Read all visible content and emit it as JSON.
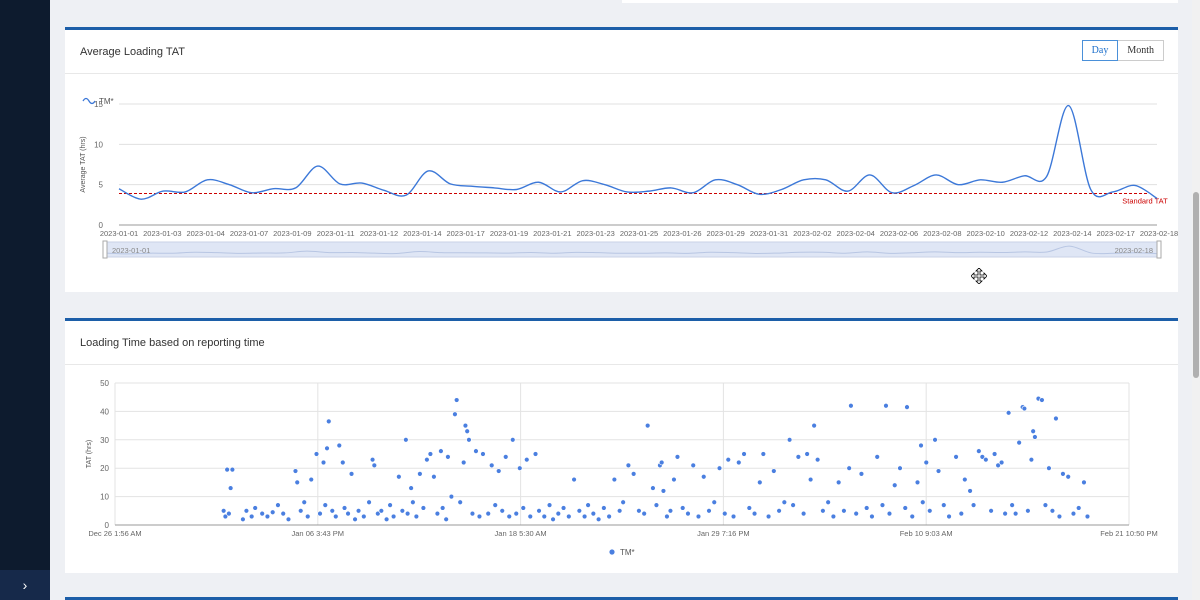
{
  "sidebar": {
    "toggle_icon": "chevron-right-icon",
    "toggle_glyph": "›"
  },
  "card1": {
    "title": "Average Loading TAT",
    "toggle": {
      "day_label": "Day",
      "month_label": "Month",
      "selected": "Day"
    }
  },
  "card2": {
    "title": "Loading Time based on reporting time"
  },
  "colors": {
    "accent": "#1c5ea8",
    "series": "#3c78d8",
    "scatter": "#4a7fe0",
    "standard_line": "#cc0000"
  },
  "chart_data": [
    {
      "type": "line",
      "title": "",
      "legend": {
        "entries": [
          "TM*"
        ],
        "placement": "top-left"
      },
      "ylabel": "Average TAT (hrs)",
      "xlabel": "",
      "ylim": [
        0,
        15
      ],
      "yticks": [
        0,
        5,
        10,
        15
      ],
      "xtick_labels": [
        "2023-01-01",
        "2023-01-03",
        "2023-01-04",
        "2023-01-07",
        "2023-01-09",
        "2023-01-11",
        "2023-01-12",
        "2023-01-14",
        "2023-01-17",
        "2023-01-19",
        "2023-01-21",
        "2023-01-23",
        "2023-01-25",
        "2023-01-26",
        "2023-01-29",
        "2023-01-31",
        "2023-02-02",
        "2023-02-04",
        "2023-02-06",
        "2023-02-08",
        "2023-02-10",
        "2023-02-12",
        "2023-02-14",
        "2023-02-17",
        "2023-02-18"
      ],
      "series": [
        {
          "name": "TM*",
          "values": [
            4.5,
            3.2,
            4.2,
            4.1,
            5.6,
            5.0,
            4.0,
            4.5,
            4.6,
            7.3,
            5.1,
            5.2,
            4.3,
            3.7,
            6.7,
            5.1,
            4.8,
            4.6,
            4.4,
            5.3,
            4.1,
            5.5,
            5.0,
            4.1,
            4.2,
            4.6,
            4.0,
            5.6,
            5.0,
            3.8,
            4.4,
            5.6,
            5.6,
            4.2,
            6.2,
            4.0,
            4.9,
            6.2,
            5.0,
            5.6,
            5.3,
            6.1,
            6.0,
            14.8,
            4.4,
            4.1,
            4.9,
            3.3
          ]
        }
      ],
      "reference_line": {
        "label": "Standard TAT",
        "value": 3.9
      },
      "grid": true,
      "zoom_slider": {
        "start_label": "2023-01-01",
        "end_label": "2023-02-18",
        "start_fraction": 0,
        "end_fraction": 1
      }
    },
    {
      "type": "scatter",
      "title": "",
      "ylabel": "TAT (hrs)",
      "xlabel": "",
      "ylim": [
        0,
        50
      ],
      "yticks": [
        0,
        10,
        20,
        30,
        40,
        50
      ],
      "xtick_labels": [
        "Dec 26 1:56 AM",
        "Jan 06 3:43 PM",
        "Jan 18 5:30 AM",
        "Jan 29 7:16 PM",
        "Feb 10 9:03 AM",
        "Feb 21 10:50 PM"
      ],
      "xlim_days": [
        0,
        57.87
      ],
      "legend": {
        "entries": [
          "TM*"
        ],
        "placement": "bottom-center"
      },
      "grid": true,
      "series": [
        {
          "name": "TM*",
          "points": [
            [
              6.2,
              5
            ],
            [
              6.3,
              3
            ],
            [
              6.4,
              19.5
            ],
            [
              6.5,
              4
            ],
            [
              6.6,
              13
            ],
            [
              6.7,
              19.5
            ],
            [
              7.3,
              2
            ],
            [
              7.5,
              5
            ],
            [
              7.8,
              3
            ],
            [
              8.0,
              6
            ],
            [
              8.4,
              4
            ],
            [
              8.7,
              3
            ],
            [
              9.0,
              4.5
            ],
            [
              9.3,
              7
            ],
            [
              9.6,
              4
            ],
            [
              9.9,
              2
            ],
            [
              10.3,
              19
            ],
            [
              10.4,
              15
            ],
            [
              10.6,
              5
            ],
            [
              10.8,
              8
            ],
            [
              11.0,
              3
            ],
            [
              11.2,
              16
            ],
            [
              11.5,
              25
            ],
            [
              11.7,
              4
            ],
            [
              11.9,
              22
            ],
            [
              12.0,
              7
            ],
            [
              12.1,
              27
            ],
            [
              12.2,
              36.5
            ],
            [
              12.4,
              5
            ],
            [
              12.6,
              3
            ],
            [
              12.8,
              28
            ],
            [
              13.0,
              22
            ],
            [
              13.1,
              6
            ],
            [
              13.3,
              4
            ],
            [
              13.5,
              18
            ],
            [
              13.7,
              2
            ],
            [
              13.9,
              5
            ],
            [
              14.2,
              3
            ],
            [
              14.5,
              8
            ],
            [
              14.7,
              23
            ],
            [
              14.8,
              21
            ],
            [
              15.0,
              4
            ],
            [
              15.2,
              5
            ],
            [
              15.5,
              2
            ],
            [
              15.7,
              7
            ],
            [
              15.9,
              3
            ],
            [
              16.2,
              17
            ],
            [
              16.4,
              5
            ],
            [
              16.6,
              30
            ],
            [
              16.7,
              4
            ],
            [
              16.9,
              13
            ],
            [
              17.0,
              8
            ],
            [
              17.2,
              3
            ],
            [
              17.4,
              18
            ],
            [
              17.6,
              6
            ],
            [
              17.8,
              23
            ],
            [
              18.0,
              25
            ],
            [
              18.2,
              17
            ],
            [
              18.4,
              4
            ],
            [
              18.6,
              26
            ],
            [
              18.7,
              6
            ],
            [
              18.9,
              2
            ],
            [
              19.0,
              24
            ],
            [
              19.2,
              10
            ],
            [
              19.4,
              39
            ],
            [
              19.5,
              44
            ],
            [
              19.7,
              8
            ],
            [
              19.9,
              22
            ],
            [
              20.0,
              35
            ],
            [
              20.1,
              33
            ],
            [
              20.2,
              30
            ],
            [
              20.4,
              4
            ],
            [
              20.6,
              26
            ],
            [
              20.8,
              3
            ],
            [
              21.0,
              25
            ],
            [
              21.3,
              4
            ],
            [
              21.5,
              21
            ],
            [
              21.7,
              7
            ],
            [
              21.9,
              19
            ],
            [
              22.1,
              5
            ],
            [
              22.3,
              24
            ],
            [
              22.5,
              3
            ],
            [
              22.7,
              30
            ],
            [
              22.9,
              4
            ],
            [
              23.1,
              20
            ],
            [
              23.3,
              6
            ],
            [
              23.5,
              23
            ],
            [
              23.7,
              3
            ],
            [
              24.0,
              25
            ],
            [
              24.2,
              5
            ],
            [
              24.5,
              3
            ],
            [
              24.8,
              7
            ],
            [
              25.0,
              2
            ],
            [
              25.3,
              4
            ],
            [
              25.6,
              6
            ],
            [
              25.9,
              3
            ],
            [
              26.2,
              16
            ],
            [
              26.5,
              5
            ],
            [
              26.8,
              3
            ],
            [
              27.0,
              7
            ],
            [
              27.3,
              4
            ],
            [
              27.6,
              2
            ],
            [
              27.9,
              6
            ],
            [
              28.2,
              3
            ],
            [
              28.5,
              16
            ],
            [
              28.8,
              5
            ],
            [
              29.0,
              8
            ],
            [
              29.3,
              21
            ],
            [
              29.6,
              18
            ],
            [
              29.9,
              5
            ],
            [
              30.2,
              4
            ],
            [
              30.4,
              35
            ],
            [
              30.7,
              13
            ],
            [
              30.9,
              7
            ],
            [
              31.1,
              21
            ],
            [
              31.2,
              22
            ],
            [
              31.3,
              12
            ],
            [
              31.5,
              3
            ],
            [
              31.7,
              5
            ],
            [
              31.9,
              16
            ],
            [
              32.1,
              24
            ],
            [
              32.4,
              6
            ],
            [
              32.7,
              4
            ],
            [
              33.0,
              21
            ],
            [
              33.3,
              3
            ],
            [
              33.6,
              17
            ],
            [
              33.9,
              5
            ],
            [
              34.2,
              8
            ],
            [
              34.5,
              20
            ],
            [
              34.8,
              4
            ],
            [
              35.0,
              23
            ],
            [
              35.3,
              3
            ],
            [
              35.6,
              22
            ],
            [
              35.9,
              25
            ],
            [
              36.2,
              6
            ],
            [
              36.5,
              4
            ],
            [
              36.8,
              15
            ],
            [
              37.0,
              25
            ],
            [
              37.3,
              3
            ],
            [
              37.6,
              19
            ],
            [
              37.9,
              5
            ],
            [
              38.2,
              8
            ],
            [
              38.5,
              30
            ],
            [
              38.7,
              7
            ],
            [
              39.0,
              24
            ],
            [
              39.3,
              4
            ],
            [
              39.5,
              25
            ],
            [
              39.7,
              16
            ],
            [
              39.9,
              35
            ],
            [
              40.1,
              23
            ],
            [
              40.4,
              5
            ],
            [
              40.7,
              8
            ],
            [
              41.0,
              3
            ],
            [
              41.3,
              15
            ],
            [
              41.6,
              5
            ],
            [
              41.9,
              20
            ],
            [
              42.0,
              42
            ],
            [
              42.3,
              4
            ],
            [
              42.6,
              18
            ],
            [
              42.9,
              6
            ],
            [
              43.2,
              3
            ],
            [
              43.5,
              24
            ],
            [
              43.8,
              7
            ],
            [
              44.0,
              42
            ],
            [
              44.2,
              4
            ],
            [
              44.5,
              14
            ],
            [
              44.8,
              20
            ],
            [
              45.1,
              6
            ],
            [
              45.2,
              41.5
            ],
            [
              45.5,
              3
            ],
            [
              45.8,
              15
            ],
            [
              46.0,
              28
            ],
            [
              46.1,
              8
            ],
            [
              46.3,
              22
            ],
            [
              46.5,
              5
            ],
            [
              46.8,
              30
            ],
            [
              47.0,
              19
            ],
            [
              47.3,
              7
            ],
            [
              47.6,
              3
            ],
            [
              48.0,
              24
            ],
            [
              48.3,
              4
            ],
            [
              48.5,
              16
            ],
            [
              48.8,
              12
            ],
            [
              49.0,
              7
            ],
            [
              49.3,
              26
            ],
            [
              49.5,
              24
            ],
            [
              49.7,
              23
            ],
            [
              50.0,
              5
            ],
            [
              50.2,
              25
            ],
            [
              50.4,
              21
            ],
            [
              50.6,
              22
            ],
            [
              50.8,
              4
            ],
            [
              51.0,
              39.5
            ],
            [
              51.2,
              7
            ],
            [
              51.4,
              4
            ],
            [
              51.6,
              29
            ],
            [
              51.8,
              41.5
            ],
            [
              51.9,
              41
            ],
            [
              52.1,
              5
            ],
            [
              52.3,
              23
            ],
            [
              52.4,
              33
            ],
            [
              52.5,
              31
            ],
            [
              52.7,
              44.5
            ],
            [
              52.9,
              44
            ],
            [
              53.1,
              7
            ],
            [
              53.3,
              20
            ],
            [
              53.5,
              5
            ],
            [
              53.7,
              37.5
            ],
            [
              53.9,
              3
            ],
            [
              54.1,
              18
            ],
            [
              54.4,
              17
            ],
            [
              54.7,
              4
            ],
            [
              55.0,
              6
            ],
            [
              55.3,
              15
            ],
            [
              55.5,
              3
            ]
          ]
        }
      ]
    }
  ]
}
